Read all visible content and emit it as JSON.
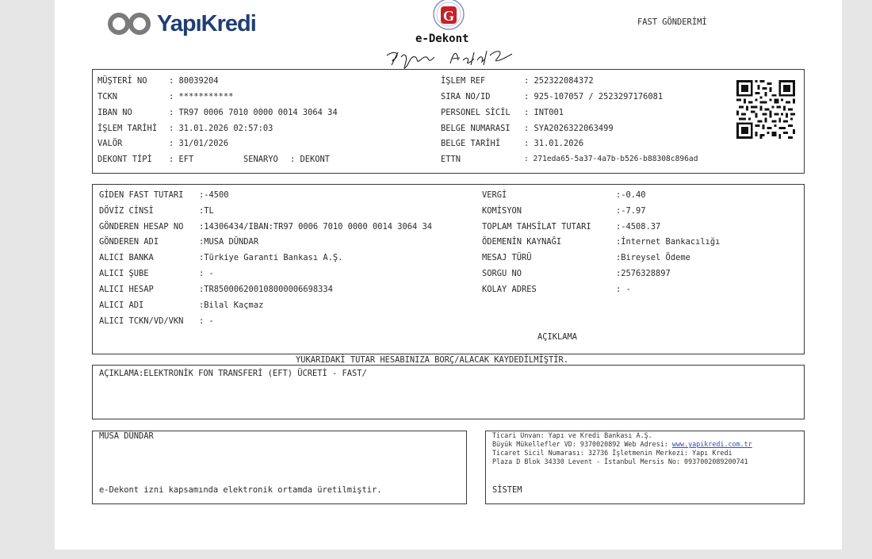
{
  "header": {
    "brand": "YapıKredi",
    "doc_title": "e-Dekont",
    "doc_type": "FAST GÖNDERİMİ"
  },
  "customer": {
    "musteri_no_label": "MÜŞTERİ NO",
    "musteri_no": ": 80039204",
    "tckn_label": "TCKN",
    "tckn": ": ***********",
    "iban_label": "IBAN NO",
    "iban": ": TR97 0006 7010 0000 0014 3064 34",
    "islem_tarihi_label": "İŞLEM TARİHİ",
    "islem_tarihi": ": 31.01.2026 02:57:03",
    "valor_label": "VALÖR",
    "valor": ": 31/01/2026",
    "dekont_tipi_label": "DEKONT TİPİ",
    "dekont_tipi": ": EFT",
    "senaryo_label": "SENARYO",
    "senaryo": ": DEKONT",
    "islem_ref_label": "İŞLEM REF",
    "islem_ref": ": 252322084372",
    "sira_no_label": "SIRA NO/ID",
    "sira_no": ": 925-107057 / 2523297176081",
    "personel_label": "PERSONEL SİCİL",
    "personel": ": INT001",
    "belge_no_label": "BELGE NUMARASI",
    "belge_no": ": SYA2026322063499",
    "belge_tarihi_label": "BELGE TARİHİ",
    "belge_tarihi": ": 31.01.2026",
    "ettn_label": "ETTN",
    "ettn": ": 271eda65-5a37-4a7b-b526-b88308c896ad"
  },
  "transfer": {
    "giden_label": "GİDEN FAST TUTARI",
    "giden": ":-4500",
    "doviz_label": "DÖVİZ CİNSİ",
    "doviz": ":TL",
    "gonderen_hesap_label": "GÖNDEREN HESAP NO",
    "gonderen_hesap": ":14306434/IBAN:TR97 0006 7010 0000 0014 3064 34",
    "gonderen_adi_label": "GÖNDEREN ADI",
    "gonderen_adi": ":MUSA DÜNDAR",
    "alici_banka_label": "ALICI BANKA",
    "alici_banka": ":Türkiye Garanti Bankası A.Ş.",
    "alici_sube_label": "ALICI ŞUBE",
    "alici_sube": ": -",
    "alici_hesap_label": "ALICI HESAP",
    "alici_hesap": ":TR850006200108000006698334",
    "alici_adi_label": "ALICI ADI",
    "alici_adi": ":Bilal Kaçmaz",
    "alici_tckn_label": "ALICI TCKN/VD/VKN",
    "alici_tckn": ": -",
    "vergi_label": "VERGİ",
    "vergi": ":-0.40",
    "komisyon_label": "KOMİSYON",
    "komisyon": ":-7.97",
    "toplam_label": "TOPLAM TAHSİLAT TUTARI",
    "toplam": ":-4508.37",
    "kaynak_label": "ÖDEMENİN KAYNAĞI",
    "kaynak": ":İnternet Bankacılığı",
    "mesaj_label": "MESAJ TÜRÜ",
    "mesaj": ":Bireysel Ödeme",
    "sorgu_label": "SORGU NO",
    "sorgu": ":2576328897",
    "kolay_label": "KOLAY ADRES",
    "kolay": ": -",
    "aciklama_heading": "AÇIKLAMA"
  },
  "notice": "YUKARIDAKİ TUTAR HESABINIZA BORÇ/ALACAK KAYDEDİLMİŞTİR.",
  "description": "AÇIKLAMA:ELEKTRONİK FON TRANSFERİ (EFT) ÜCRETİ - FAST/",
  "footer_left": {
    "name": "MUSA DÜNDAR",
    "note": "e-Dekont izni kapsamında elektronik ortamda üretilmiştir."
  },
  "footer_right": {
    "line1": "Ticari Unvan: Yapı ve Kredi Bankası A.Ş.",
    "line2_prefix": "Büyük Mükellefler VD: 9370020892 Web Adresi: ",
    "line2_link": "www.yapikredi.com.tr",
    "line3": "Ticaret Sicil Numarası: 32736 İşletmenin Merkezi: Yapı Kredi",
    "line4": "Plaza D Blok 34330 Levent - İstanbul Mersis No: 0937002089200741",
    "system": "SİSTEM"
  },
  "colors": {
    "brand_blue": "#1f3e73",
    "stamp_red": "#c8202a",
    "page_bg": "#e6e6e6"
  }
}
